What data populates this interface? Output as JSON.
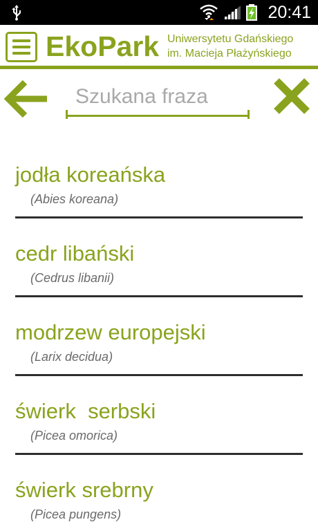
{
  "status_bar": {
    "time": "20:41",
    "icons": [
      "usb-icon",
      "wifi-icon",
      "signal-icon",
      "battery-charging-icon"
    ]
  },
  "header": {
    "app_name": "EkoPark",
    "subtitle_line1": "Uniwersytetu Gdańskiego",
    "subtitle_line2": "im. Macieja Płażyńskiego",
    "menu_icon": "hamburger-menu-icon"
  },
  "search": {
    "placeholder": "Szukana fraza",
    "value": "",
    "back_icon": "arrow-left-icon",
    "clear_icon": "close-icon"
  },
  "results": [
    {
      "name": "jodła koreańska",
      "latin": "(Abies koreana)"
    },
    {
      "name": "cedr libański",
      "latin": "(Cedrus libanii)"
    },
    {
      "name": "modrzew europejski",
      "latin": "(Larix decidua)"
    },
    {
      "name": "świerk  serbski",
      "latin": "(Picea omorica)"
    },
    {
      "name": "świerk srebrny",
      "latin": "(Picea pungens)"
    }
  ],
  "colors": {
    "accent": "#8aa31e",
    "status_bar": "#000000",
    "divider": "#2e2e2e",
    "latin_text": "#6a6a6a"
  }
}
